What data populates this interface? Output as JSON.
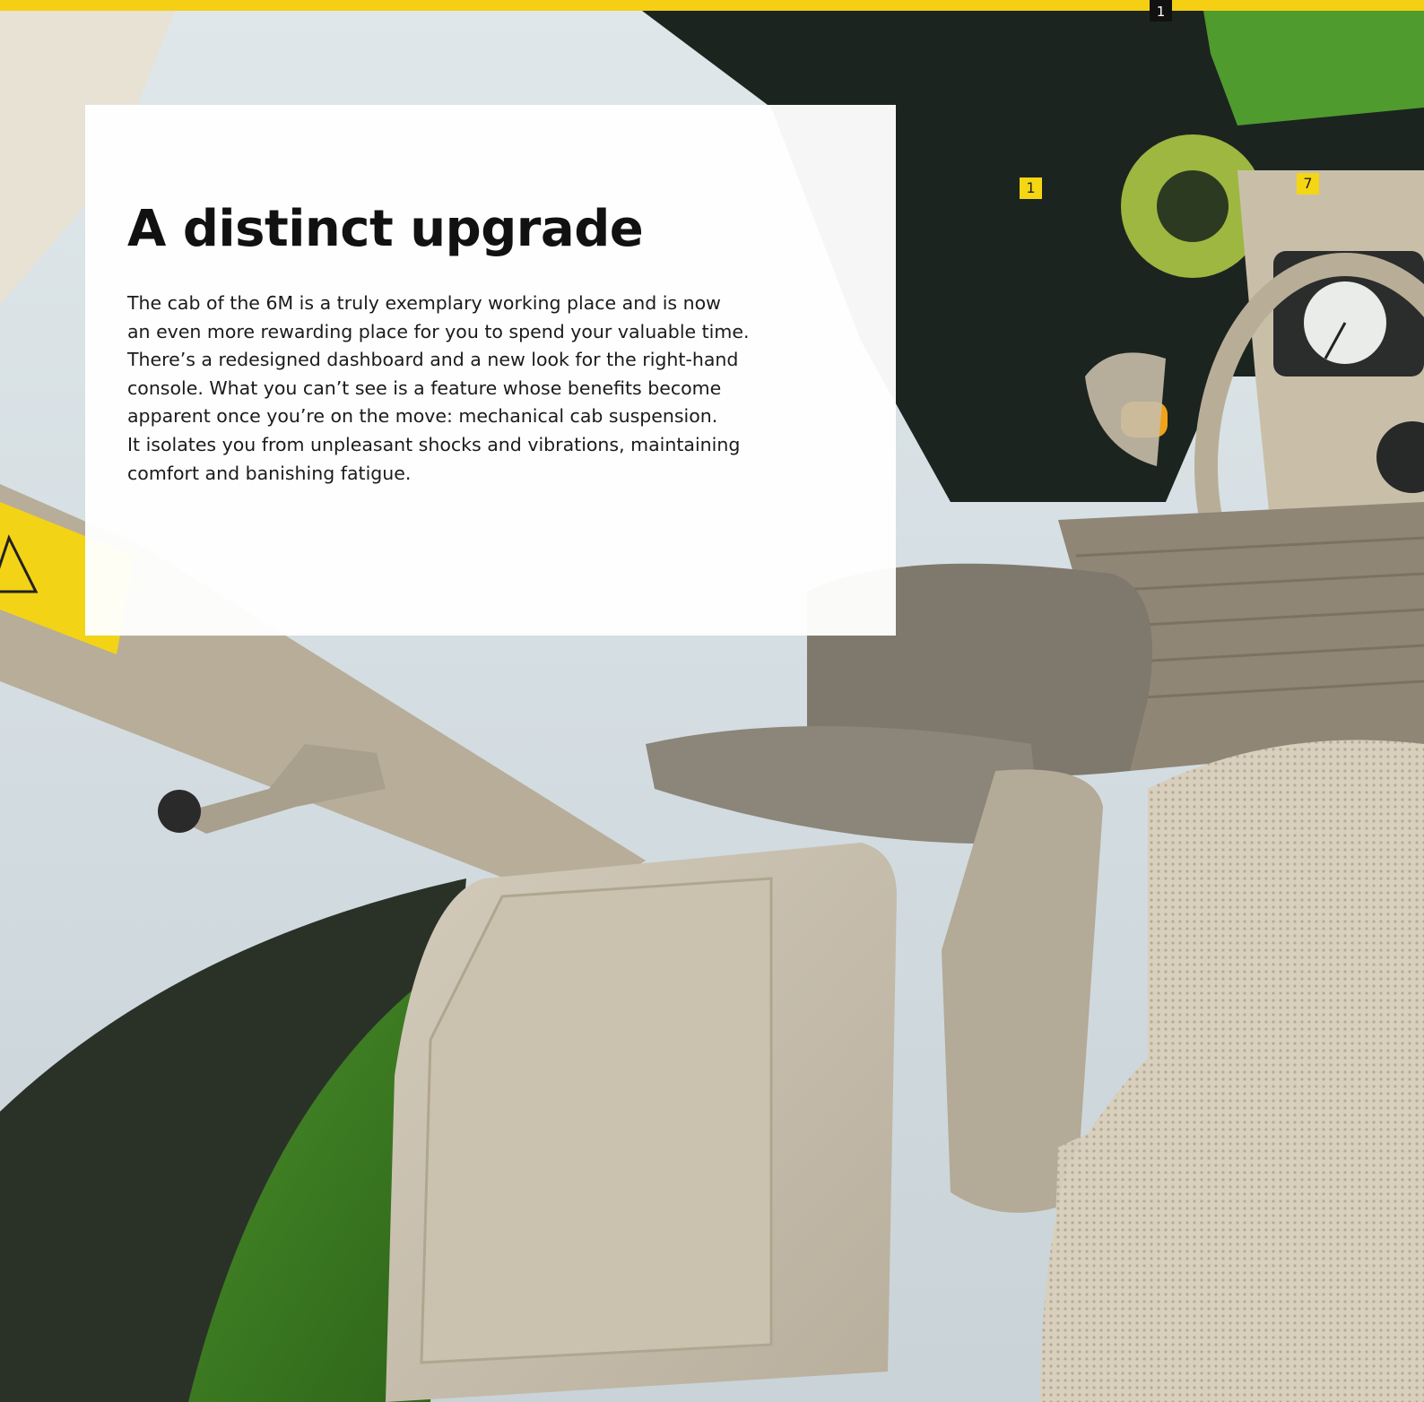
{
  "page": {
    "number": "1",
    "accent_color": "#f5cf13"
  },
  "markers": [
    "1",
    "7"
  ],
  "article": {
    "headline": "A distinct upgrade",
    "body": "The cab of the 6M is a truly exemplary working place and is now\nan even more rewarding place for you to spend your valuable time.\nThere’s a redesigned dashboard and a new look for the right-hand\nconsole. What you can’t see is a feature whose benefits become\napparent once you’re on the move: mechanical cab suspension.\nIt isolates you from unpleasant shocks and vibrations, maintaining\ncomfort and banishing fatigue."
  }
}
